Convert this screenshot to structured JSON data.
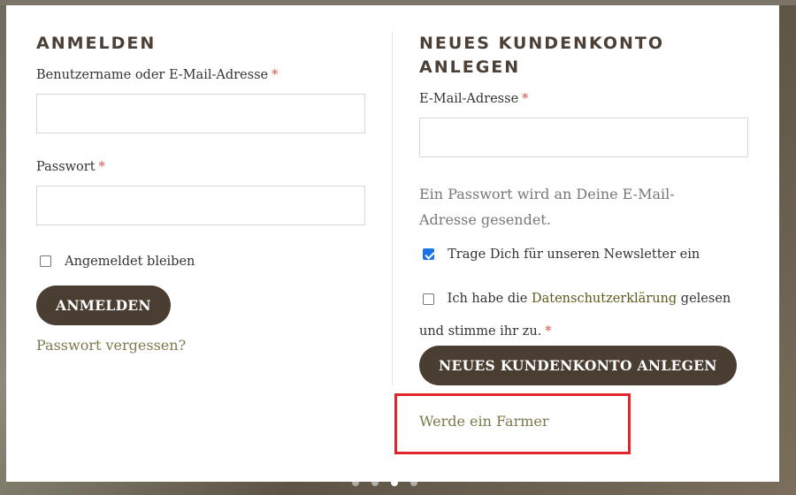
{
  "login": {
    "heading": "ANMELDEN",
    "username_label": "Benutzername oder E-Mail-Adresse",
    "username_value": "",
    "password_label": "Passwort",
    "password_value": "",
    "remember_label": "Angemeldet bleiben",
    "remember_checked": false,
    "submit_label": "ANMELDEN",
    "forgot_link": "Passwort vergessen?"
  },
  "register": {
    "heading": "NEUES KUNDENKONTO ANLEGEN",
    "email_label": "E-Mail-Adresse",
    "email_value": "",
    "password_note": "Ein Passwort wird an Deine E-Mail-Adresse gesendet.",
    "newsletter_label": "Trage Dich für unseren Newsletter ein",
    "newsletter_checked": true,
    "privacy_prefix": "Ich habe die",
    "privacy_link": "Datenschutzerklärung",
    "privacy_suffix": "gelesen und stimme ihr zu.",
    "submit_label": "NEUES KUNDENKONTO ANLEGEN",
    "farmer_link": "Werde ein Farmer"
  },
  "required_marker": "*",
  "colors": {
    "button_bg": "#4a3d31",
    "heading": "#4b3f36",
    "link_olive": "#7c7a4c",
    "required": "#d9534f",
    "annotation": "#e1252a"
  }
}
